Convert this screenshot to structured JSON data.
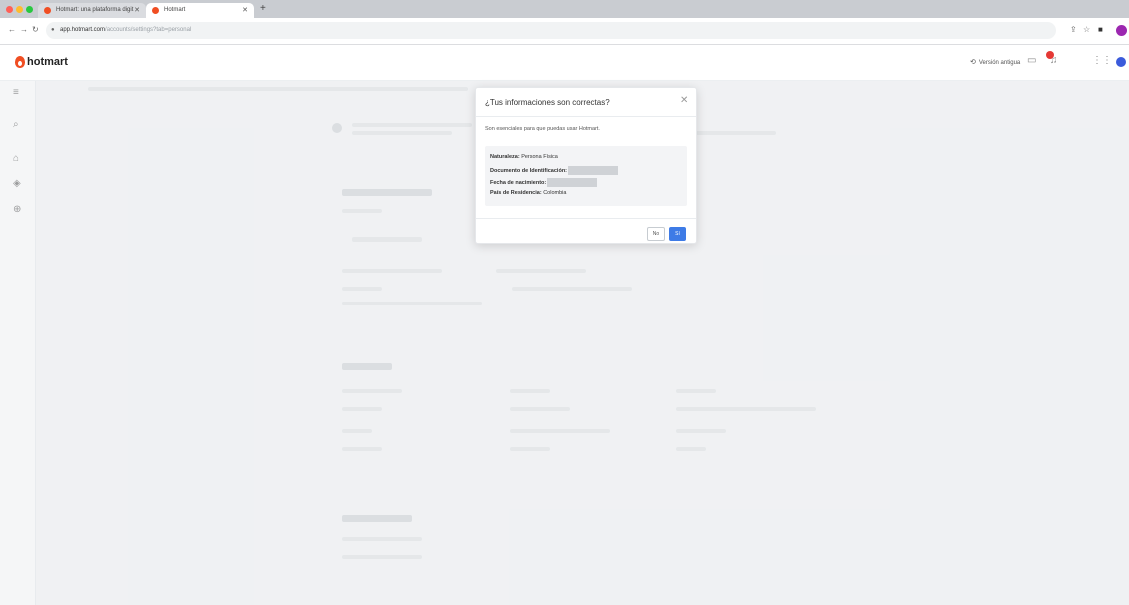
{
  "browser": {
    "tabs": [
      {
        "title": "Hotmart: una plataforma digit",
        "active": false
      },
      {
        "title": "Hotmart",
        "active": true
      }
    ],
    "url_host": "app.hotmart.com",
    "url_path": "/accounts/settings?tab=personal"
  },
  "header": {
    "logo": "hotmart",
    "old_version": "Versión antigua"
  },
  "icons": {
    "menu": "menu-icon",
    "search": "search-icon",
    "products": "graduation-cap-icon",
    "box": "box-icon",
    "money": "dollar-icon"
  },
  "modal": {
    "title": "¿Tus informaciones son correctas?",
    "subtitle": "Son esenciales para que puedas usar Hotmart.",
    "rows": [
      {
        "label": "Naturaleza:",
        "value": "Persona Física"
      },
      {
        "label": "Documento de Identificación:",
        "value": ""
      },
      {
        "label": "Fecha de nacimiento:",
        "value": ""
      },
      {
        "label": "País de Residencia:",
        "value": "Colombia"
      }
    ],
    "no_label": "No",
    "yes_label": "Sí"
  },
  "colors": {
    "brand": "#f04e23",
    "primary_button": "#3e7be6",
    "notification": "#e53935"
  }
}
